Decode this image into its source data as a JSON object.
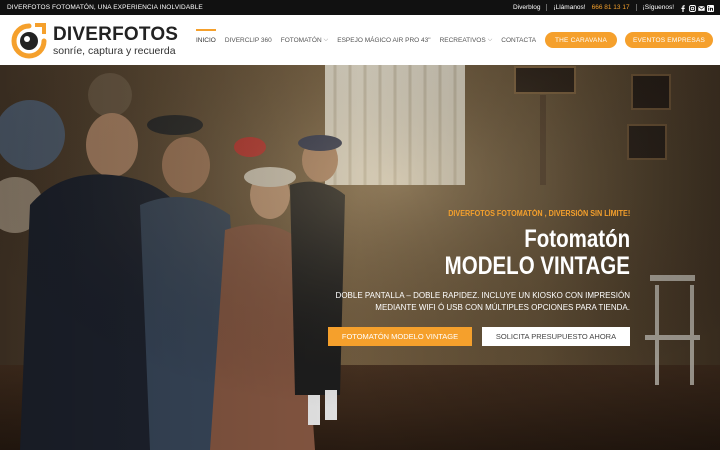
{
  "topbar": {
    "tagline": "DIVERFOTOS FOTOMATÓN, UNA EXPERIENCIA INOLVIDABLE",
    "blog": "Diverblog",
    "call_label": "¡Llámanos!",
    "phone": "666 81 13 17",
    "follow_label": "¡Síguenos!",
    "social_icons": [
      "facebook-icon",
      "instagram-icon",
      "email-icon",
      "linkedin-icon"
    ]
  },
  "logo": {
    "brand": "DIVERFOTOS",
    "slogan": "sonríe, captura y recuerda"
  },
  "nav": {
    "items": [
      {
        "label": "INICIO",
        "active": true,
        "dropdown": false
      },
      {
        "label": "DIVERCLIP 360",
        "active": false,
        "dropdown": false
      },
      {
        "label": "FOTOMATÓN",
        "active": false,
        "dropdown": true
      },
      {
        "label": "ESPEJO MÁGICO AIR PRO 43\"",
        "active": false,
        "dropdown": false
      },
      {
        "label": "RECREATIVOS",
        "active": false,
        "dropdown": true
      },
      {
        "label": "CONTACTA",
        "active": false,
        "dropdown": false
      }
    ],
    "caravana_label": "THE CARAVANA",
    "empresas_label": "EVENTOS EMPRESAS"
  },
  "hero": {
    "kicker": "DIVERFOTOS FOTOMATÓN , DIVERSIÓN SIN LÍMITE!",
    "title_line1": "Fotomatón",
    "title_line2": "MODELO VINTAGE",
    "description": "DOBLE PANTALLA – DOBLE RAPIDEZ. INCLUYE UN KIOSKO CON IMPRESIÓN MEDIANTE WIFI Ó USB CON MÚLTIPLES OPCIONES PARA TIENDA.",
    "cta_primary": "FOTOMATÓN MODELO VINTAGE",
    "cta_secondary": "SOLICITA PRESUPUESTO AHORA"
  },
  "colors": {
    "accent": "#f5a02c",
    "topbar_bg": "#111111",
    "header_bg": "#ffffff"
  }
}
